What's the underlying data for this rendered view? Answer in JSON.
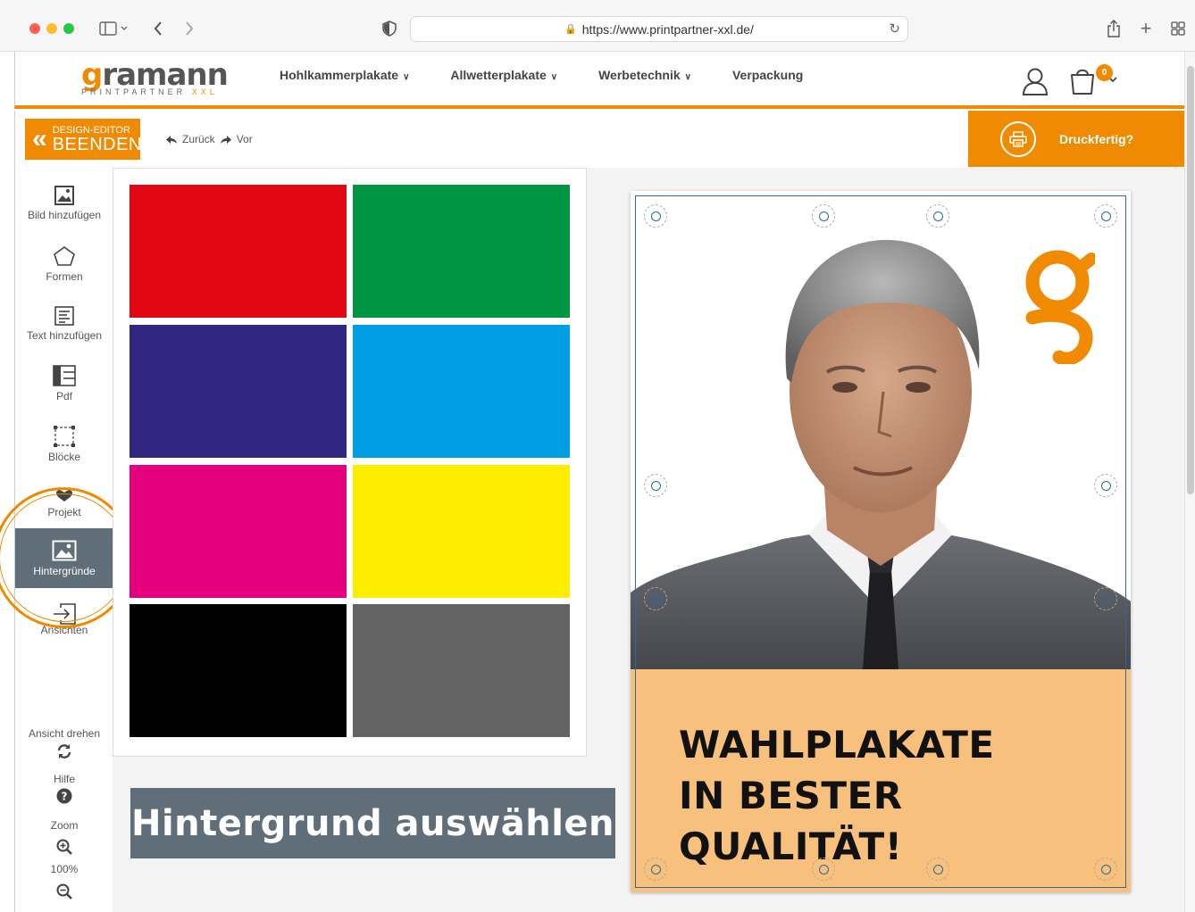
{
  "browser": {
    "url": "https://www.printpartner-xxl.de/"
  },
  "header": {
    "logo_word_g": "g",
    "logo_word_rest": "ramann",
    "logo_sub": "PRINTPARTNER",
    "logo_sub_xxl": "XXL",
    "nav": [
      {
        "label": "Hohlkammerplakate",
        "dropdown": true
      },
      {
        "label": "Allwetterplakate",
        "dropdown": true
      },
      {
        "label": "Werbetechnik",
        "dropdown": true
      },
      {
        "label": "Verpackung",
        "dropdown": false
      }
    ],
    "cart_count": "0",
    "accent": "#f08a00"
  },
  "editor": {
    "exit_line1": "DESIGN-EDITOR",
    "exit_line2": "BEENDEN",
    "undo": "Zurück",
    "redo": "Vor",
    "print_ready": "Druckfertig?"
  },
  "sidebar": {
    "items": [
      {
        "label": "Bild hinzufügen",
        "icon": "image-add-icon"
      },
      {
        "label": "Formen",
        "icon": "pentagon-icon"
      },
      {
        "label": "Text hinzufügen",
        "icon": "text-icon"
      },
      {
        "label": "Pdf",
        "icon": "pdf-icon"
      },
      {
        "label": "Blöcke",
        "icon": "blocks-icon"
      },
      {
        "label": "Projekt",
        "icon": "heart-icon"
      },
      {
        "label": "Hintergründe",
        "icon": "background-image-icon",
        "active": true
      },
      {
        "label": "Ansichten",
        "icon": "exit-arrow-icon"
      }
    ],
    "rotate_view": "Ansicht drehen",
    "help": "Hilfe",
    "zoom": "Zoom",
    "zoom_value": "100%"
  },
  "backgrounds": {
    "swatches": [
      {
        "name": "rot",
        "color": "#e30613"
      },
      {
        "name": "grün",
        "color": "#009540"
      },
      {
        "name": "dunkelblau",
        "color": "#312783"
      },
      {
        "name": "cyan",
        "color": "#009fe3"
      },
      {
        "name": "magenta",
        "color": "#e5007d"
      },
      {
        "name": "gelb",
        "color": "#ffed00"
      },
      {
        "name": "schwarz",
        "color": "#000000"
      },
      {
        "name": "grau",
        "color": "#636363"
      }
    ],
    "caption": "Hintergrund auswählen"
  },
  "poster": {
    "headline_line1": "WAHLPLAKATE",
    "headline_line2": "IN BESTER QUALITÄT!",
    "bottom_color": "#f7c17d",
    "logo_letter": "g"
  }
}
